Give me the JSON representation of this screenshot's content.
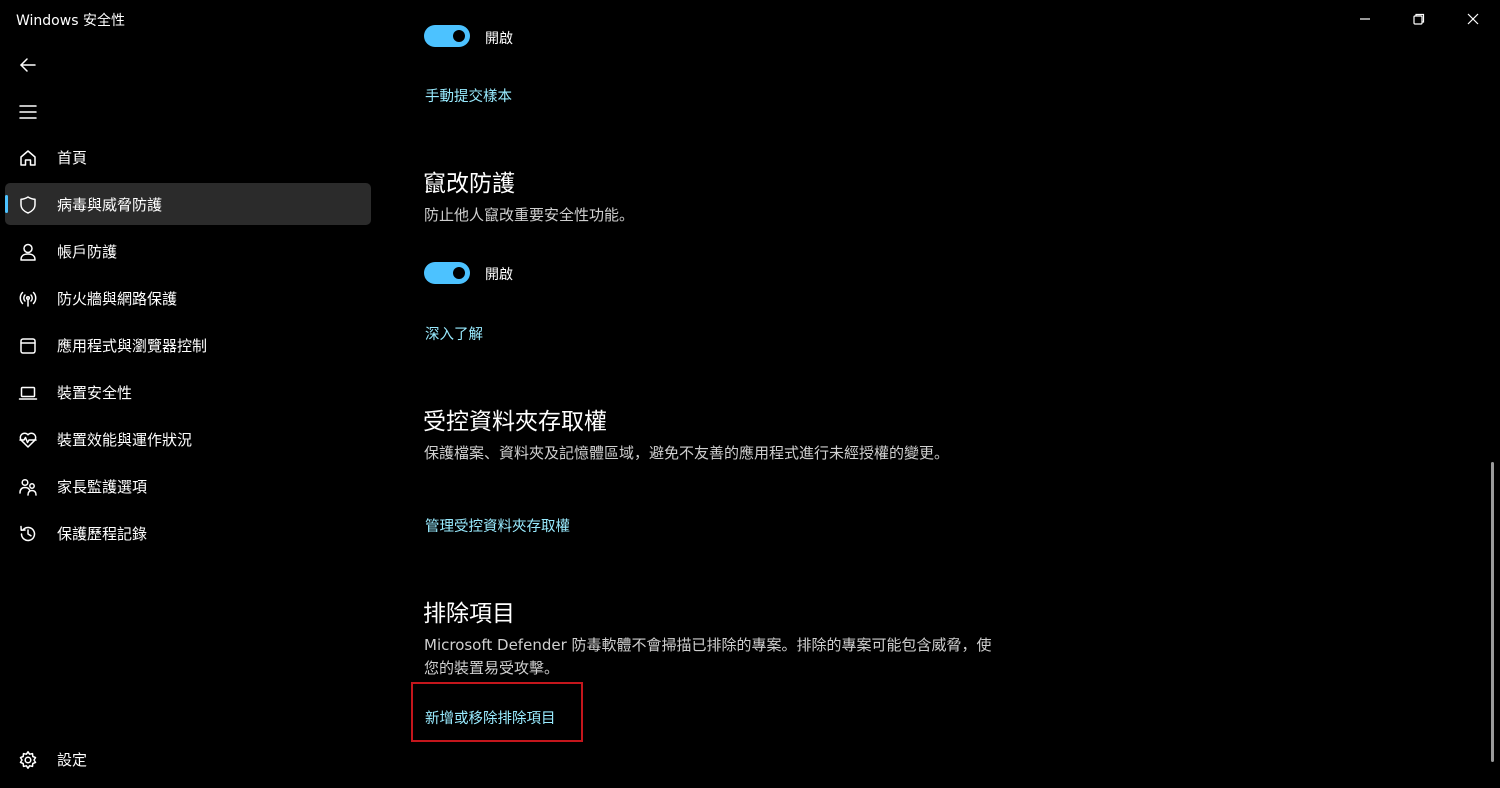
{
  "window": {
    "title": "Windows 安全性"
  },
  "nav": {
    "items": [
      {
        "label": "首頁",
        "icon": "home-icon"
      },
      {
        "label": "病毒與威脅防護",
        "icon": "shield-icon",
        "selected": true
      },
      {
        "label": "帳戶防護",
        "icon": "person-icon"
      },
      {
        "label": "防火牆與網路保護",
        "icon": "wireless-icon"
      },
      {
        "label": "應用程式與瀏覽器控制",
        "icon": "app-window-icon"
      },
      {
        "label": "裝置安全性",
        "icon": "laptop-icon"
      },
      {
        "label": "裝置效能與運作狀況",
        "icon": "heart-pulse-icon"
      },
      {
        "label": "家長監護選項",
        "icon": "family-icon"
      },
      {
        "label": "保護歷程記錄",
        "icon": "history-icon"
      }
    ],
    "settings_label": "設定"
  },
  "content": {
    "top": {
      "toggle_label": "開啟",
      "toggle_on": true,
      "submit_link": "手動提交樣本"
    },
    "tamper": {
      "title": "竄改防護",
      "description": "防止他人竄改重要安全性功能。",
      "toggle_label": "開啟",
      "toggle_on": true,
      "link": "深入了解"
    },
    "cfa": {
      "title": "受控資料夾存取權",
      "description": "保護檔案、資料夾及記憶體區域，避免不友善的應用程式進行未經授權的變更。",
      "link": "管理受控資料夾存取權"
    },
    "exclusions": {
      "title": "排除項目",
      "description": "Microsoft Defender 防毒軟體不會掃描已排除的專案。排除的專案可能包含威脅，使您的裝置易受攻擊。",
      "link": "新增或移除排除項目"
    }
  },
  "colors": {
    "accent": "#4cc2ff",
    "link": "#99ebff",
    "highlight_box": "#c4161c",
    "background": "#000000"
  }
}
